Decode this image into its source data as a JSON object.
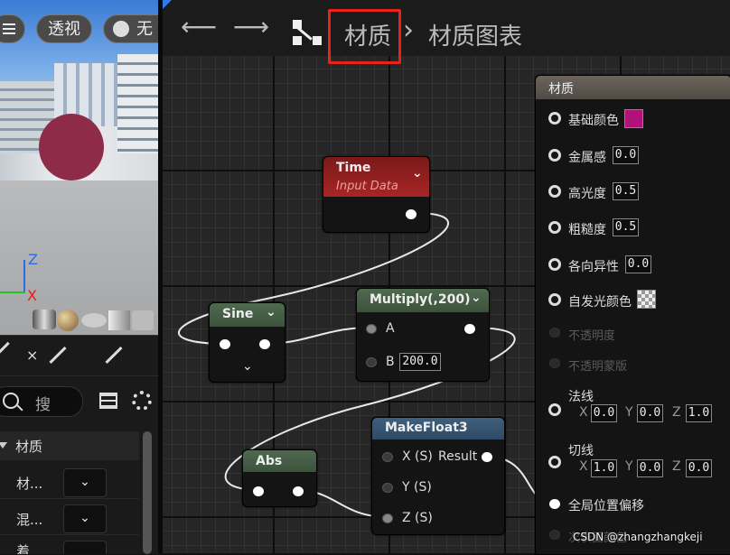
{
  "viewport": {
    "menu_icon": "hamburger-icon",
    "perspective_label": "透视",
    "lit_label": "无",
    "axis_z": "Z",
    "axis_x": "X",
    "sphere_color": "#8e2b48"
  },
  "panel": {
    "search_placeholder": "搜",
    "category": "材质",
    "rows": [
      {
        "label": "材..."
      },
      {
        "label": "混..."
      },
      {
        "label": "着"
      }
    ]
  },
  "toolbar": {
    "breadcrumb_root": "材质",
    "breadcrumb_separator": "›",
    "breadcrumb_current": "材质图表",
    "highlight_color": "#e8241a"
  },
  "nodes": {
    "time": {
      "title": "Time",
      "subtitle": "Input Data"
    },
    "sine": {
      "title": "Sine"
    },
    "multiply": {
      "title": "Multiply(,200)",
      "pin_a": "A",
      "pin_b": "B",
      "b_value": "200.0"
    },
    "abs": {
      "title": "Abs"
    },
    "makefloat3": {
      "title": "MakeFloat3",
      "pin_x": "X (S)",
      "pin_result": "Result",
      "pin_y": "Y (S)",
      "pin_z": "Z (S)"
    }
  },
  "material_node": {
    "title": "材质",
    "base_color": "#b0127a",
    "inputs": {
      "base_color": "基础颜色",
      "metallic": "金属感",
      "metallic_value": "0.0",
      "specular": "高光度",
      "specular_value": "0.5",
      "roughness": "粗糙度",
      "roughness_value": "0.5",
      "anisotropy": "各向异性",
      "anisotropy_value": "0.0",
      "emissive": "自发光颜色",
      "opacity": "不透明度",
      "opacity_mask": "不透明蒙版",
      "normal": "法线",
      "normal_x": "0.0",
      "normal_y": "0.0",
      "normal_z": "1.0",
      "tangent": "切线",
      "tangent_x": "1.0",
      "tangent_y": "0.0",
      "tangent_z": "0.0",
      "wpo": "全局位置偏移",
      "more": "次表面颜色",
      "x": "X",
      "y": "Y",
      "z": "Z"
    }
  },
  "watermark": "CSDN @zhangzhangkeji"
}
